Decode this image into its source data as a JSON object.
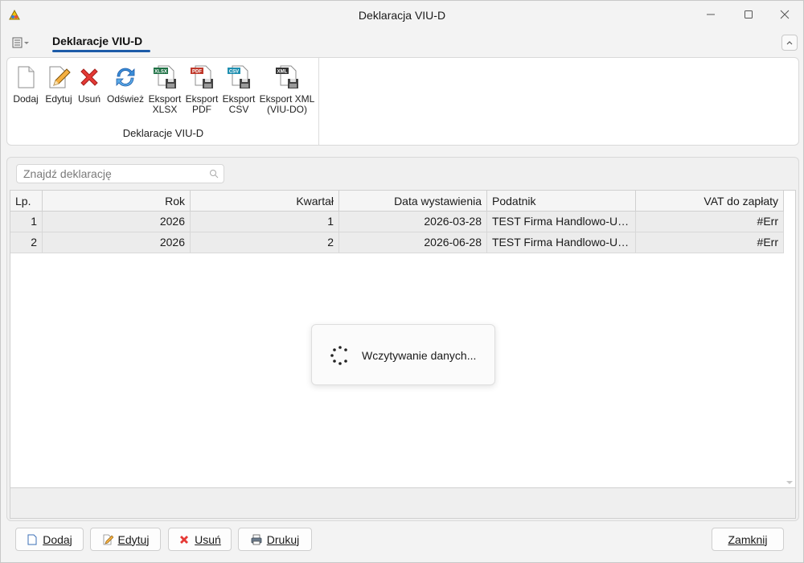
{
  "window": {
    "title": "Deklaracja VIU-D"
  },
  "ribbon": {
    "tab_label": "Deklaracje VIU-D",
    "group_label": "Deklaracje VIU-D",
    "buttons": [
      {
        "label": "Dodaj",
        "icon": "document-icon"
      },
      {
        "label": "Edytuj",
        "icon": "edit-pencil-icon"
      },
      {
        "label": "Usuń",
        "icon": "delete-x-icon"
      },
      {
        "label": "Odśwież",
        "icon": "refresh-icon"
      },
      {
        "label_line1": "Eksport",
        "label_line2": "XLSX",
        "icon": "xlsx-file-icon"
      },
      {
        "label_line1": "Eksport",
        "label_line2": "PDF",
        "icon": "pdf-file-icon"
      },
      {
        "label_line1": "Eksport",
        "label_line2": "CSV",
        "icon": "csv-file-icon"
      },
      {
        "label_line1": "Eksport XML",
        "label_line2": "(VIU-DO)",
        "icon": "xml-file-icon"
      }
    ],
    "badges": {
      "xlsx": "XLSX",
      "pdf": "PDF",
      "csv": "CSV",
      "xml": "XML"
    },
    "colors": {
      "xlsx": "#1e7145",
      "pdf": "#c0392b",
      "csv": "#1f8fb0",
      "xml": "#333333"
    }
  },
  "search": {
    "placeholder": "Znajdź deklarację"
  },
  "table": {
    "columns": [
      "Lp.",
      "Rok",
      "Kwartał",
      "Data wystawienia",
      "Podatnik",
      "VAT do zapłaty"
    ],
    "rows": [
      {
        "lp": "1",
        "rok": "2026",
        "kwartal": "1",
        "data": "2026-03-28",
        "podatnik": "TEST Firma Handlowo-Usł...",
        "vat": "#Err"
      },
      {
        "lp": "2",
        "rok": "2026",
        "kwartal": "2",
        "data": "2026-06-28",
        "podatnik": "TEST Firma Handlowo-Usł...",
        "vat": "#Err"
      }
    ]
  },
  "loading": {
    "text": "Wczytywanie danych..."
  },
  "footer": {
    "add_label": "Dodaj",
    "edit_label": "Edytuj",
    "delete_label": "Usuń",
    "print_label": "Drukuj",
    "close_label": "Zamknij"
  }
}
